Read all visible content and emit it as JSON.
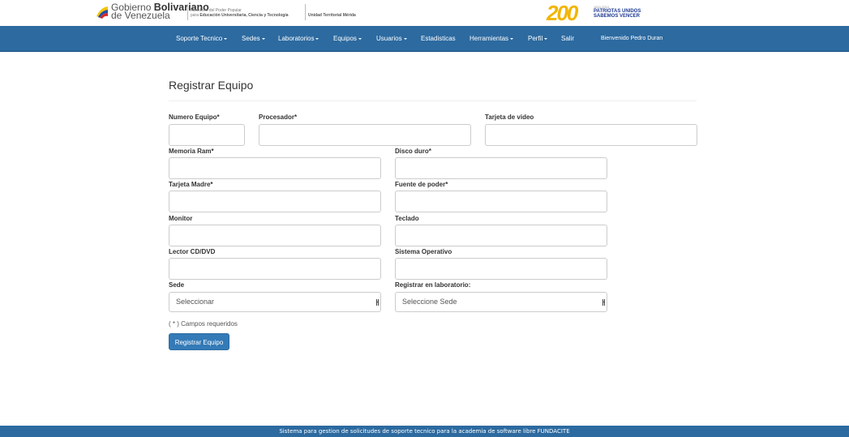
{
  "header": {
    "gov_name_bold": "Bolivariano",
    "gov_name_1": "Gobierno",
    "gov_name_2": "de Venezuela",
    "ministry_line1": "Ministerio del Poder Popular",
    "ministry_line2_prefix": "para",
    "ministry_line2_bold": "Educación Universitaria, Ciencia y Tecnología",
    "unit": "Unidad Territorial Mérida",
    "bicent_number": "200",
    "bicent_years": "1810-2010",
    "bicent_line1": "PATRIOTAS UNIDOS",
    "bicent_line2": "SABEMOS VENCER"
  },
  "nav": {
    "soporte": "Soporte Tecnico",
    "sedes": "Sedes",
    "laboratorios": "Laboratorios",
    "equipos": "Equipos",
    "usuarios": "Usuarios",
    "estadisticas": "Estadisticas",
    "herramientas": "Herramientas",
    "perfil": "Perfil",
    "salir": "Salir",
    "welcome": "Bienvenido Pedro Duran"
  },
  "page": {
    "title": "Registrar Equipo",
    "required_note": "( * ) Campos requeridos",
    "submit": "Registrar Equipo"
  },
  "form": {
    "numero_equipo": "Numero Equipo*",
    "procesador": "Procesador*",
    "tarjeta_video": "Tarjeta de video",
    "memoria_ram": "Memoria Ram*",
    "disco_duro": "Disco duro*",
    "tarjeta_madre": "Tarjeta Madre*",
    "fuente_poder": "Fuente de poder*",
    "monitor": "Monitor",
    "teclado": "Teclado",
    "lector": "Lector CD/DVD",
    "sistema_operativo": "Sistema Operativo",
    "sede": "Sede",
    "sede_value": "Seleccionar",
    "laboratorio": "Registrar en laboratorio:",
    "laboratorio_value": "Seleccione Sede"
  },
  "footer": {
    "text": "Sistema para gestion de solicitudes de soporte tecnico para la academia de software libre FUNDACITE"
  },
  "colors": {
    "navbar": "#2c6aa0",
    "button": "#337ab7",
    "bicent_gold": "#f2b500",
    "bicent_blue": "#1f3a93"
  }
}
